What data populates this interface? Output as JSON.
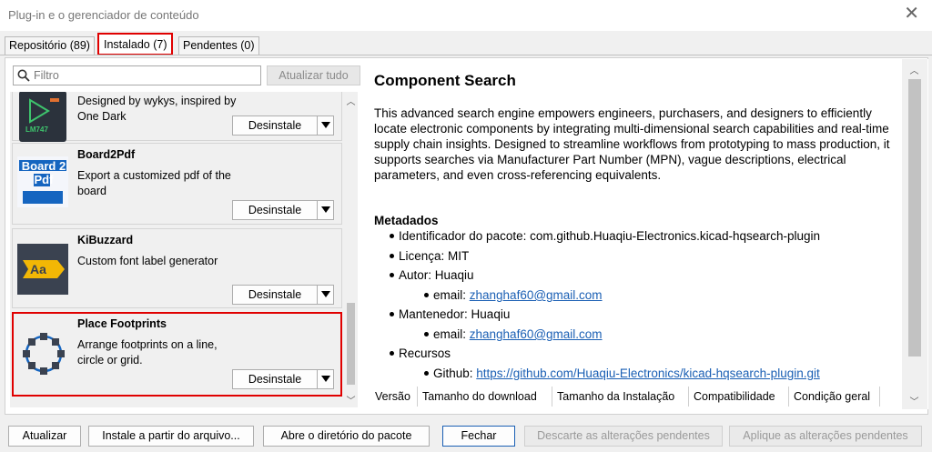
{
  "window": {
    "title": "Plug-in e o gerenciador de conteúdo"
  },
  "tabs": [
    {
      "label": "Repositório (89)"
    },
    {
      "label": "Instalado (7)"
    },
    {
      "label": "Pendentes (0)"
    }
  ],
  "search": {
    "placeholder": "Filtro",
    "refresh_label": "Atualizar tudo"
  },
  "packages": [
    {
      "name": "",
      "description": "Designed by wykys, inspired by One Dark",
      "icon_text": "LM747",
      "uninstall_label": "Desinstale"
    },
    {
      "name": "Board2Pdf",
      "description": "Export a customized pdf of the board",
      "icon_text": "Board 2 Pdf",
      "uninstall_label": "Desinstale"
    },
    {
      "name": "KiBuzzard",
      "description": "Custom font label generator",
      "icon_text": "Aa",
      "uninstall_label": "Desinstale"
    },
    {
      "name": "Place Footprints",
      "description": "Arrange footprints on a line, circle or grid.",
      "uninstall_label": "Desinstale"
    }
  ],
  "detail": {
    "title": "Component Search",
    "description": "This advanced search engine empowers engineers, purchasers, and designers to efficiently locate electronic components by integrating multi-dimensional search capabilities and real-time supply chain insights. Designed to streamline workflows from prototyping to mass production, it supports searches via Manufacturer Part Number (MPN), vague descriptions, electrical parameters, and even cross-referencing equivalents.",
    "metadata_heading": "Metadados",
    "package_id": "Identificador do pacote: com.github.Huaqiu-Electronics.kicad-hqsearch-plugin",
    "license": "Licença: MIT",
    "author": "Autor: Huaqiu",
    "email_label": "email: ",
    "author_email": "zhanghaf60@gmail.com",
    "maintainer": "Mantenedor: Huaqiu",
    "maintainer_email": "zhanghaf60@gmail.com",
    "resources": "Recursos",
    "github_label": "Github: ",
    "github_url": "https://github.com/Huaqiu-Electronics/kicad-hqsearch-plugin.git"
  },
  "columns": [
    "Versão",
    "Tamanho do download",
    "Tamanho da Instalação",
    "Compatibilidade",
    "Condição geral"
  ],
  "footer": {
    "update": "Atualizar",
    "install_from_file": "Instale a partir do arquivo...",
    "open_package_dir": "Abre o diretório do pacote",
    "close": "Fechar",
    "discard": "Descarte as alterações pendentes",
    "apply": "Aplique as alterações pendentes"
  },
  "colors": {
    "highlight": "#e00000",
    "link": "#1a5fb4",
    "icon_dark": "#3a4250",
    "icon_blue": "#1565c0"
  }
}
